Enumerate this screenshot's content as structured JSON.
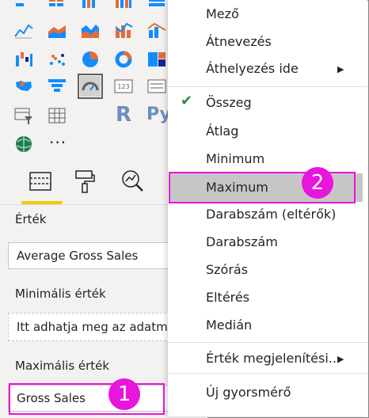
{
  "visualizations": {
    "icons": [
      "stacked-bar-chart-icon",
      "stacked-column-chart-icon",
      "clustered-bar-chart-icon",
      "clustered-column-chart-icon",
      "100-percent-bar-chart-icon",
      "line-chart-icon",
      "area-chart-icon",
      "stacked-area-chart-icon",
      "line-and-column-chart-icon",
      "line-and-stacked-column-chart-icon",
      "waterfall-chart-icon",
      "scatter-chart-icon",
      "pie-chart-icon",
      "donut-chart-icon",
      "treemap-icon",
      "filled-map-icon",
      "funnel-icon",
      "gauge-icon",
      "card-icon",
      "multi-row-card-icon",
      "slicer-icon",
      "table-icon",
      "r-visual-icon",
      "python-visual-icon",
      "arcgis-map-icon"
    ],
    "r_label": "R",
    "py_label": "Py",
    "more_label": "···",
    "selected": "gauge-icon"
  },
  "pane_tabs": [
    "fields-tab-icon",
    "format-tab-icon",
    "analytics-tab-icon"
  ],
  "field_wells": {
    "value_label": "Érték",
    "value_field": "Average Gross Sales",
    "min_label": "Minimális érték",
    "min_placeholder": "Itt adhatja meg az adatmezőket",
    "max_label": "Maximális érték",
    "max_field": "Gross Sales"
  },
  "context_menu": {
    "items": [
      "Mező",
      "Átnevezés",
      "Áthelyezés ide",
      "Összeg",
      "Átlag",
      "Minimum",
      "Maximum",
      "Darabszám (eltérők)",
      "Darabszám",
      "Szórás",
      "Eltérés",
      "Medián",
      "Érték megjelenítési...",
      "Új gyorsmérő"
    ],
    "checked_item": "Összeg",
    "highlighted_item": "Maximum"
  },
  "callouts": {
    "badge_1": "1",
    "badge_2": "2",
    "accent_color": "#e815dc"
  },
  "colors": {
    "pane_bg": "#f3f2f1",
    "tab_underline": "#f2c811",
    "check": "#2b8a3e",
    "chart_teal": "#118dff",
    "chart_orange": "#e66c37"
  }
}
